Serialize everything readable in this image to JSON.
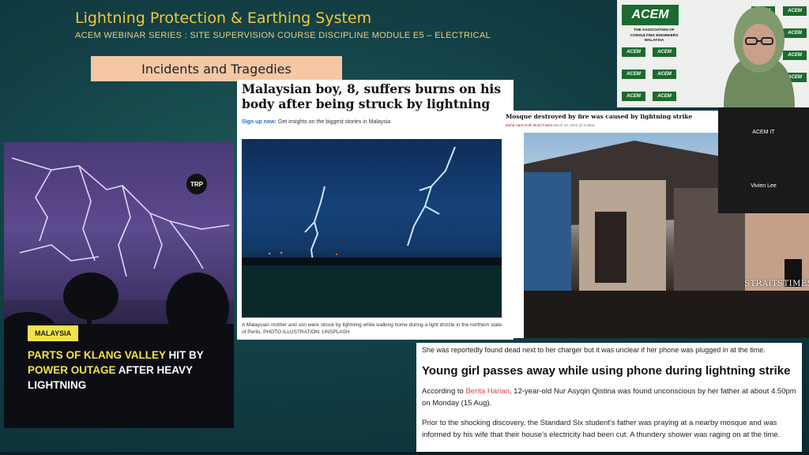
{
  "slide": {
    "title": "Lightning Protection & Earthing System",
    "subtitle": "ACEM WEBINAR SERIES : SITE SUPERVISION COURSE DISCIPLINE MODULE E5 – ELECTRICAL",
    "banner": "Incidents and Tragedies"
  },
  "trp_post": {
    "logo": "TRP",
    "tag": "MALAYSIA",
    "headline_1": "PARTS OF KLANG VALLEY",
    "headline_2": " HIT BY ",
    "headline_3": "POWER OUTAGE",
    "headline_4": " AFTER HEAVY LIGHTNING"
  },
  "article1": {
    "headline": "Malaysian boy, 8, suffers burns on his body after being struck by lightning",
    "signup_link": "Sign up now:",
    "signup_text": " Get insights on the biggest stories in Malaysia",
    "caption": "A Malaysian mother and son were struck by lightning while walking home during a light drizzle in the northern state of Perlis. PHOTO ILLUSTRATION: UNSPLASH"
  },
  "article2": {
    "headline": "Mosque destroyed by fire was caused by lightning strike",
    "byline": "Mohd Haris Rofil Mohd Faskil",
    "date": " March 16, 2023 @ 9:08am",
    "watermark": "STRAITSTIMES"
  },
  "article3": {
    "lead": "She was reportedly found dead next to her charger but it was unclear if her phone was plugged in at the time.",
    "headline": "Young girl passes away while using phone during lightning strike",
    "p1_prefix": "According to ",
    "p1_link": "Berita Harian",
    "p1_rest": ", 12-year-old Nur Asyqin Qistina was found unconscious by her father at about 4.50pm on Monday (15 Aug).",
    "p2": "Prior to the shocking discovery, the Standard Six student's father was praying at a nearby mosque and was informed by his wife that their house's electricity had been cut. A thundery shower was raging on at the time."
  },
  "webcam": {
    "logo": "ACEM",
    "org_name": "THE ASSOCIATION OF CONSULTING ENGINEERS MALAYSIA",
    "tile_text": "ACEM"
  },
  "participants": [
    {
      "name": "ACEM IT"
    },
    {
      "name": "Vivien Lee"
    }
  ]
}
